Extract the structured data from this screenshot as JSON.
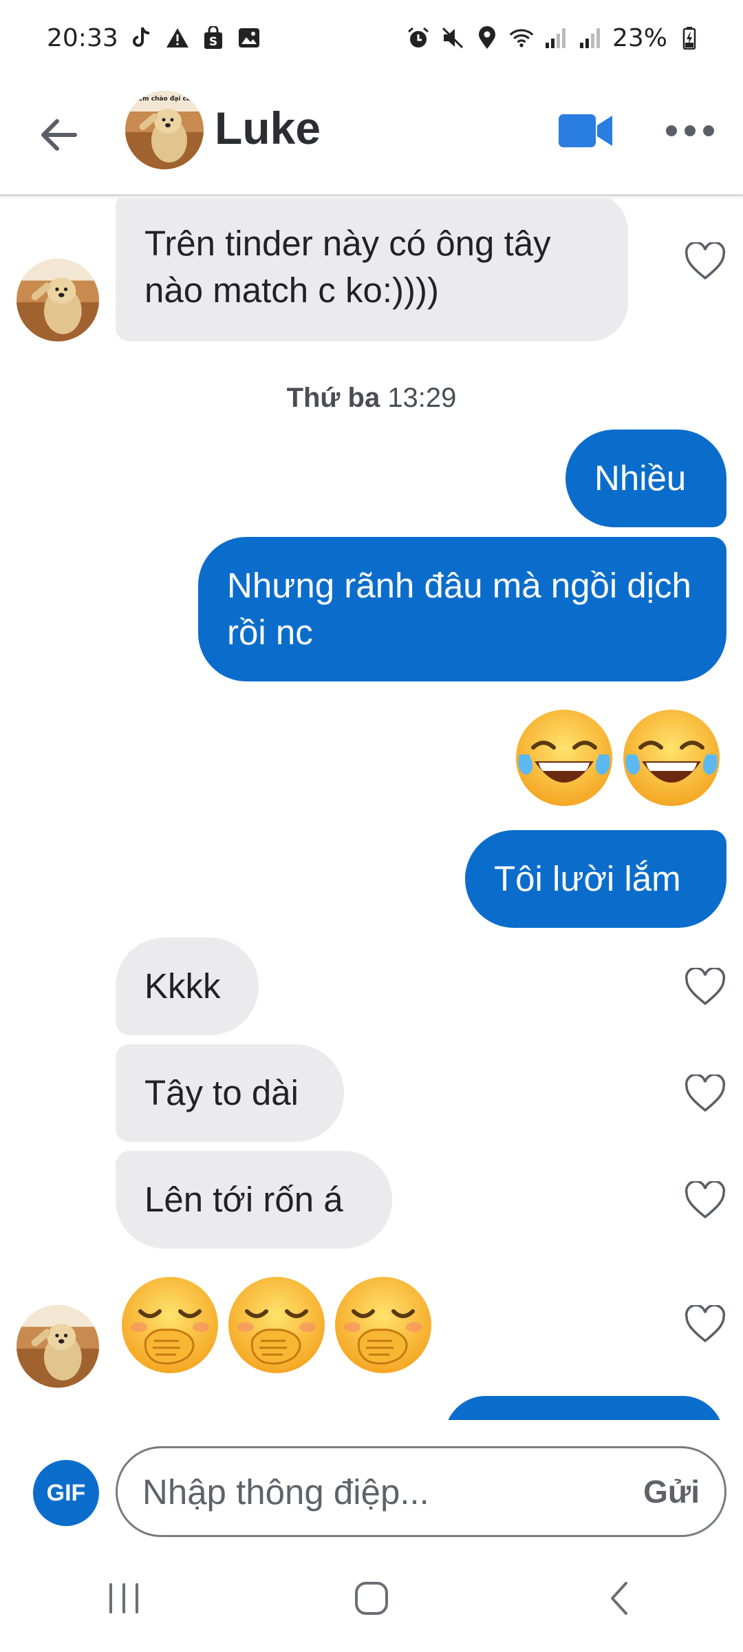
{
  "status_bar": {
    "time": "20:33",
    "battery": "23%",
    "left_icons": [
      "tiktok-icon",
      "warning-icon",
      "shop-icon",
      "image-icon"
    ],
    "right_icons": [
      "alarm-icon",
      "mute-icon",
      "location-icon",
      "wifi-icon",
      "signal-icon",
      "signal-icon",
      "battery-icon"
    ]
  },
  "header": {
    "contact_name": "Luke",
    "avatar_caption": "Em chào đại ca"
  },
  "messages": {
    "m1": "Trên tinder này có ông tây nào match c ko:))))",
    "timestamp_day": "Thứ ba",
    "timestamp_time": "13:29",
    "m2": "Nhiều",
    "m3": "Nhưng rãnh đâu mà ngồi dịch rồi nc",
    "m4_emoji": "😂😂",
    "m5": "Tôi lười lắm",
    "m6": "Kkkk",
    "m7": "Tây to dài",
    "m8": "Lên tới rốn á",
    "m9_emoji": "🤭🤭🤭"
  },
  "composer": {
    "gif_label": "GIF",
    "placeholder": "Nhập thông điệp...",
    "send_label": "Gửi"
  },
  "colors": {
    "outgoing_bubble": "#0b6dcb",
    "incoming_bubble": "#ebebee",
    "accent": "#2a7de1"
  }
}
